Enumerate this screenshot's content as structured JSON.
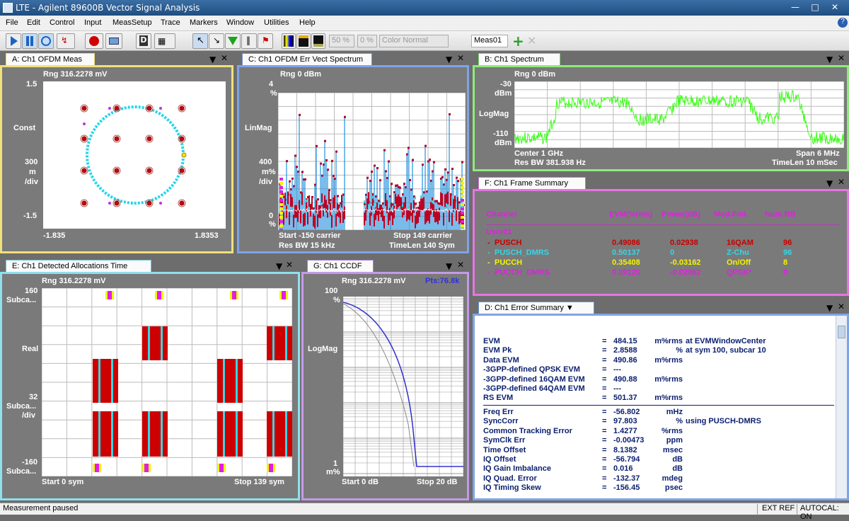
{
  "app": {
    "title": "LTE - Agilent 89600B Vector Signal Analysis"
  },
  "menu": [
    "File",
    "Edit",
    "Control",
    "Input",
    "MeasSetup",
    "Trace",
    "Markers",
    "Window",
    "Utilities",
    "Help"
  ],
  "toolbar": {
    "pct1": "50 %",
    "pct2": "0 %",
    "color_mode": "Color Normal",
    "meas": "Meas01"
  },
  "panelA": {
    "tab": "A: Ch1 OFDM Meas",
    "rng": "Rng 316.2278 mV",
    "ytop": "1.5",
    "ymid": "Const",
    "ydiv": [
      "300",
      "m",
      "/div"
    ],
    "ybot": "-1.5",
    "xleft": "-1.835",
    "xright": "1.8353"
  },
  "panelC": {
    "tab": "C: Ch1 OFDM Err Vect Spectrum",
    "rng": "Rng 0 dBm",
    "ytop": [
      "4",
      "%"
    ],
    "ymid": "LinMag",
    "ydiv": [
      "400",
      "m%",
      "/div"
    ],
    "ybot": [
      "0",
      "%"
    ],
    "start": "Start -150  carrier",
    "stop": "Stop 149  carrier",
    "resbw": "Res BW 15 kHz",
    "timelen": "TimeLen 140  Sym"
  },
  "panelB": {
    "tab": "B: Ch1 Spectrum",
    "rng": "Rng 0 dBm",
    "ytop": [
      "-30",
      "dBm"
    ],
    "ymid": "LogMag",
    "ybot": [
      "-110",
      "dBm"
    ],
    "center": "Center 1 GHz",
    "span": "Span 6 MHz",
    "resbw": "Res BW 381.938  Hz",
    "timelen": "TimeLen 10 mSec"
  },
  "panelF": {
    "tab": "F: Ch1 Frame Summary",
    "headers": [
      "Channel",
      "EVM(%rms)",
      "Power(dB)",
      "Mod.Fmt.",
      "Num.RB"
    ],
    "group": "User01",
    "rows": [
      {
        "name": "PUSCH",
        "evm": "0.49086",
        "power": "0.02938",
        "fmt": "16QAM",
        "rb": "96",
        "color": "#c80000"
      },
      {
        "name": "PUSCH_DMRS",
        "evm": "0.50137",
        "power": "0",
        "fmt": "Z-Chu",
        "rb": "96",
        "color": "#35d6e6"
      },
      {
        "name": "PUCCH",
        "evm": "0.35408",
        "power": "-0.03162",
        "fmt": "On/Off",
        "rb": "8",
        "color": "#f4f400"
      },
      {
        "name": "PUCCH_DMRS",
        "evm": "0.39120",
        "power": "-0.02962",
        "fmt": "QPSK*",
        "rb": "8",
        "color": "#e020e0"
      }
    ]
  },
  "panelD": {
    "tab": "D: Ch1 Error Summary",
    "lines1": [
      {
        "k": "EVM",
        "v": "484.15",
        "u": "m%rms",
        "x": "at  EVMWindowCenter"
      },
      {
        "k": "EVM Pk",
        "v": "2.8588",
        "u": "%",
        "x": "at  sym 100,   subcar  10"
      },
      {
        "k": "Data EVM",
        "v": "490.86",
        "u": "m%rms",
        "x": ""
      },
      {
        "k": " -3GPP-defined QPSK EVM",
        "v": "---",
        "u": "",
        "x": ""
      },
      {
        "k": " -3GPP-defined 16QAM EVM",
        "v": "490.88",
        "u": "m%rms",
        "x": ""
      },
      {
        "k": " -3GPP-defined 64QAM EVM",
        "v": "---",
        "u": "",
        "x": ""
      },
      {
        "k": "RS EVM",
        "v": "501.37",
        "u": "m%rms",
        "x": ""
      }
    ],
    "lines2": [
      {
        "k": "Freq Err",
        "v": "-56.802",
        "u": "mHz",
        "x": ""
      },
      {
        "k": "SyncCorr",
        "v": "97.803",
        "u": "%",
        "x": "using  PUSCH-DMRS"
      },
      {
        "k": "Common Tracking Error",
        "v": "1.4277",
        "u": "%rms",
        "x": ""
      },
      {
        "k": "SymClk Err",
        "v": "-0.00473",
        "u": "ppm",
        "x": ""
      },
      {
        "k": "Time Offset",
        "v": "8.1382",
        "u": "msec",
        "x": ""
      },
      {
        "k": "IQ Offset",
        "v": "-56.794",
        "u": "dB",
        "x": ""
      },
      {
        "k": "IQ Gain Imbalance",
        "v": "0.016",
        "u": "dB",
        "x": ""
      },
      {
        "k": "IQ Quad. Error",
        "v": "-132.37",
        "u": "mdeg",
        "x": ""
      },
      {
        "k": "IQ Timing Skew",
        "v": "-156.45",
        "u": "psec",
        "x": ""
      }
    ]
  },
  "panelE": {
    "tab": "E: Ch1 Detected Allocations Time",
    "rng": "Rng 316.2278 mV",
    "ytop": [
      "160",
      "Subca..."
    ],
    "ymid": "Real",
    "ydiv": [
      "32",
      "Subca...",
      "/div"
    ],
    "ybot": [
      "-160",
      "Subca..."
    ],
    "start": "Start 0  sym",
    "stop": "Stop 139  sym"
  },
  "panelG": {
    "tab": "G: Ch1 CCDF",
    "rng": "Rng 316.2278 mV",
    "pts": "Pts:76.8k",
    "ytop": [
      "100",
      "%"
    ],
    "ymid": "LogMag",
    "ybot": [
      "1",
      "m%"
    ],
    "start": "Start 0 dB",
    "stop": "Stop 20 dB"
  },
  "status": {
    "left": "Measurement paused",
    "ext": "EXT REF",
    "autocal": "AUTOCAL: ON"
  }
}
